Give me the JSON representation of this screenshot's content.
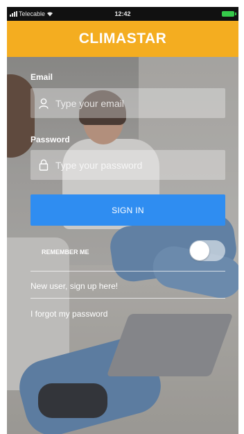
{
  "status_bar": {
    "carrier": "Telecable",
    "time": "12:42"
  },
  "header": {
    "logo": "CLIMASTAR"
  },
  "login": {
    "email_label": "Email",
    "email_placeholder": "Type your email",
    "password_label": "Password",
    "password_placeholder": "Type your password",
    "sign_in_label": "SIGN IN",
    "remember_me_label": "REMEMBER ME",
    "remember_me_on": false,
    "signup_link": "New user, sign up here!",
    "forgot_link": "I forgot my password"
  },
  "colors": {
    "header": "#f4ad20",
    "button": "#2f8df1"
  },
  "icons": [
    "wifi-icon",
    "signal-icon",
    "battery-icon",
    "user-icon",
    "lock-icon"
  ]
}
